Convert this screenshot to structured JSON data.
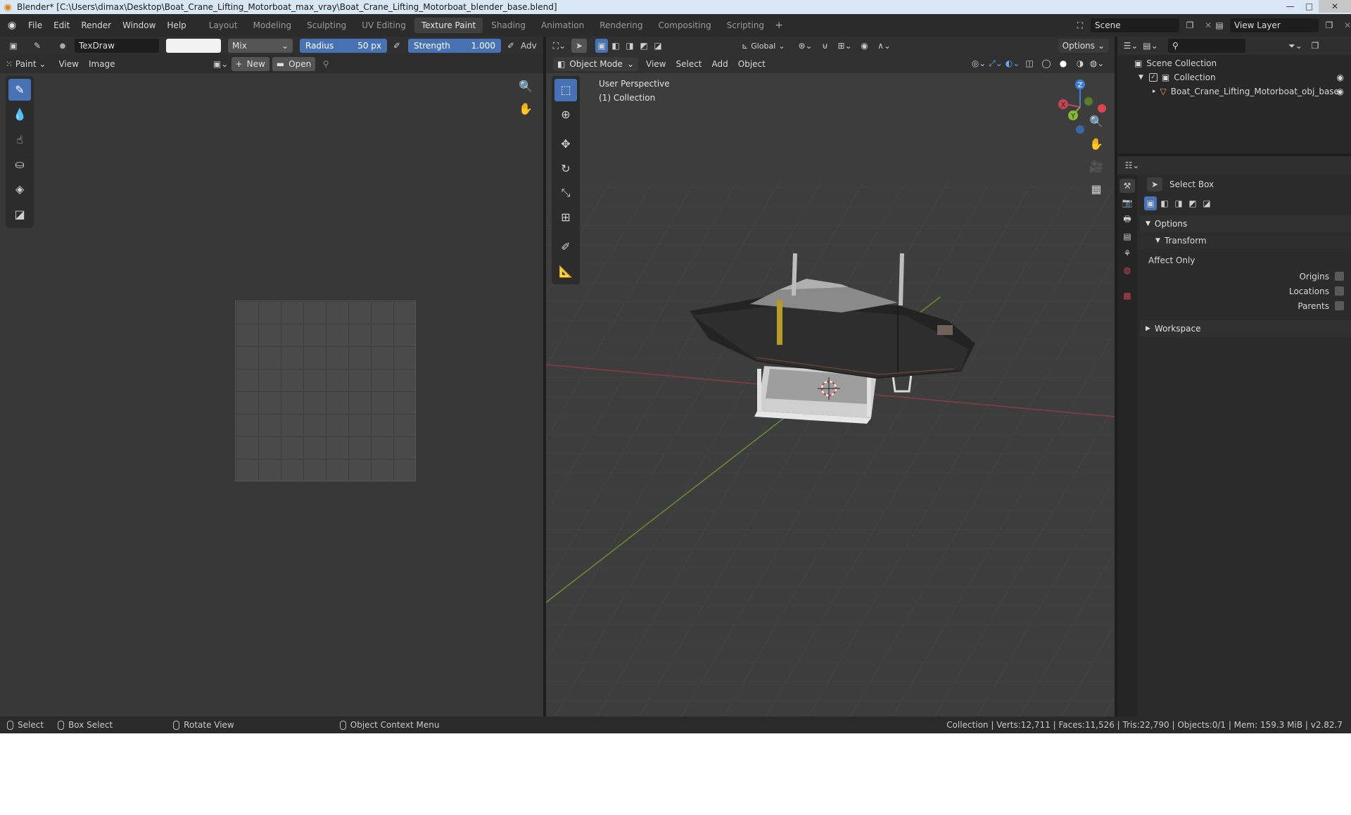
{
  "window": {
    "title": "Blender* [C:\\Users\\dimax\\Desktop\\Boat_Crane_Lifting_Motorboat_max_vray\\Boat_Crane_Lifting_Motorboat_blender_base.blend]",
    "minimize": "—",
    "maximize": "□",
    "close": "✕"
  },
  "menu": [
    "File",
    "Edit",
    "Render",
    "Window",
    "Help"
  ],
  "workspaces": [
    {
      "label": "Layout",
      "active": false
    },
    {
      "label": "Modeling",
      "active": false
    },
    {
      "label": "Sculpting",
      "active": false
    },
    {
      "label": "UV Editing",
      "active": false
    },
    {
      "label": "Texture Paint",
      "active": true
    },
    {
      "label": "Shading",
      "active": false
    },
    {
      "label": "Animation",
      "active": false
    },
    {
      "label": "Rendering",
      "active": false
    },
    {
      "label": "Compositing",
      "active": false
    },
    {
      "label": "Scripting",
      "active": false
    }
  ],
  "add_workspace": "+",
  "scene": {
    "label": "Scene"
  },
  "view_layer": {
    "label": "View Layer"
  },
  "image_editor": {
    "brush_name": "TexDraw",
    "blend_mode": "Mix",
    "radius_label": "Radius",
    "radius_value": "50 px",
    "strength_label": "Strength",
    "strength_value": "1.000",
    "advanced_label": "Adv",
    "mode": "Paint",
    "menus": [
      "View",
      "Image"
    ],
    "new_label": "New",
    "open_label": "Open",
    "tools": [
      {
        "name": "draw-tool",
        "glyph": "✎",
        "active": true
      },
      {
        "name": "soften-tool",
        "glyph": "💧",
        "active": false
      },
      {
        "name": "smear-tool",
        "glyph": "☝",
        "active": false
      },
      {
        "name": "clone-tool",
        "glyph": "⛀",
        "active": false
      },
      {
        "name": "fill-tool",
        "glyph": "◈",
        "active": false
      },
      {
        "name": "mask-tool",
        "glyph": "◪",
        "active": false
      }
    ]
  },
  "viewport": {
    "transform_orientation": "Global",
    "options_label": "Options",
    "mode": "Object Mode",
    "menus": [
      "View",
      "Select",
      "Add",
      "Object"
    ],
    "perspective_label": "User Perspective",
    "collection_label": "(1) Collection",
    "gizmo": {
      "x": "X",
      "y": "Y",
      "z": "Z"
    },
    "tools": [
      {
        "name": "select-box-tool",
        "glyph": "⬚",
        "active": true
      },
      {
        "name": "cursor-tool",
        "glyph": "⊕",
        "active": false
      },
      {
        "name": "move-tool",
        "glyph": "✥",
        "active": false
      },
      {
        "name": "rotate-tool",
        "glyph": "↻",
        "active": false
      },
      {
        "name": "scale-tool",
        "glyph": "⤡",
        "active": false
      },
      {
        "name": "transform-tool",
        "glyph": "⊞",
        "active": false
      },
      {
        "name": "annotate-tool",
        "glyph": "✐",
        "active": false
      },
      {
        "name": "measure-tool",
        "glyph": "📐",
        "active": false
      }
    ]
  },
  "outliner": {
    "root": "Scene Collection",
    "collection": "Collection",
    "object": "Boat_Crane_Lifting_Motorboat_obj_base"
  },
  "properties": {
    "tool_name": "Select Box",
    "options_label": "Options",
    "transform_label": "Transform",
    "affect_only_label": "Affect Only",
    "checkboxes": [
      {
        "label": "Origins",
        "checked": false
      },
      {
        "label": "Locations",
        "checked": false
      },
      {
        "label": "Parents",
        "checked": false
      }
    ],
    "workspace_label": "Workspace"
  },
  "statusbar": {
    "select": "Select",
    "box_select": "Box Select",
    "rotate_view": "Rotate View",
    "context_menu": "Object Context Menu",
    "stats": "Collection | Verts:12,711 | Faces:11,526 | Tris:22,790 | Objects:0/1 | Mem: 159.3 MiB | v2.82.7"
  },
  "colors": {
    "accent": "#4772b3",
    "x_axis": "#c9444f",
    "y_axis": "#86b835",
    "z_axis": "#3b7fd9"
  }
}
